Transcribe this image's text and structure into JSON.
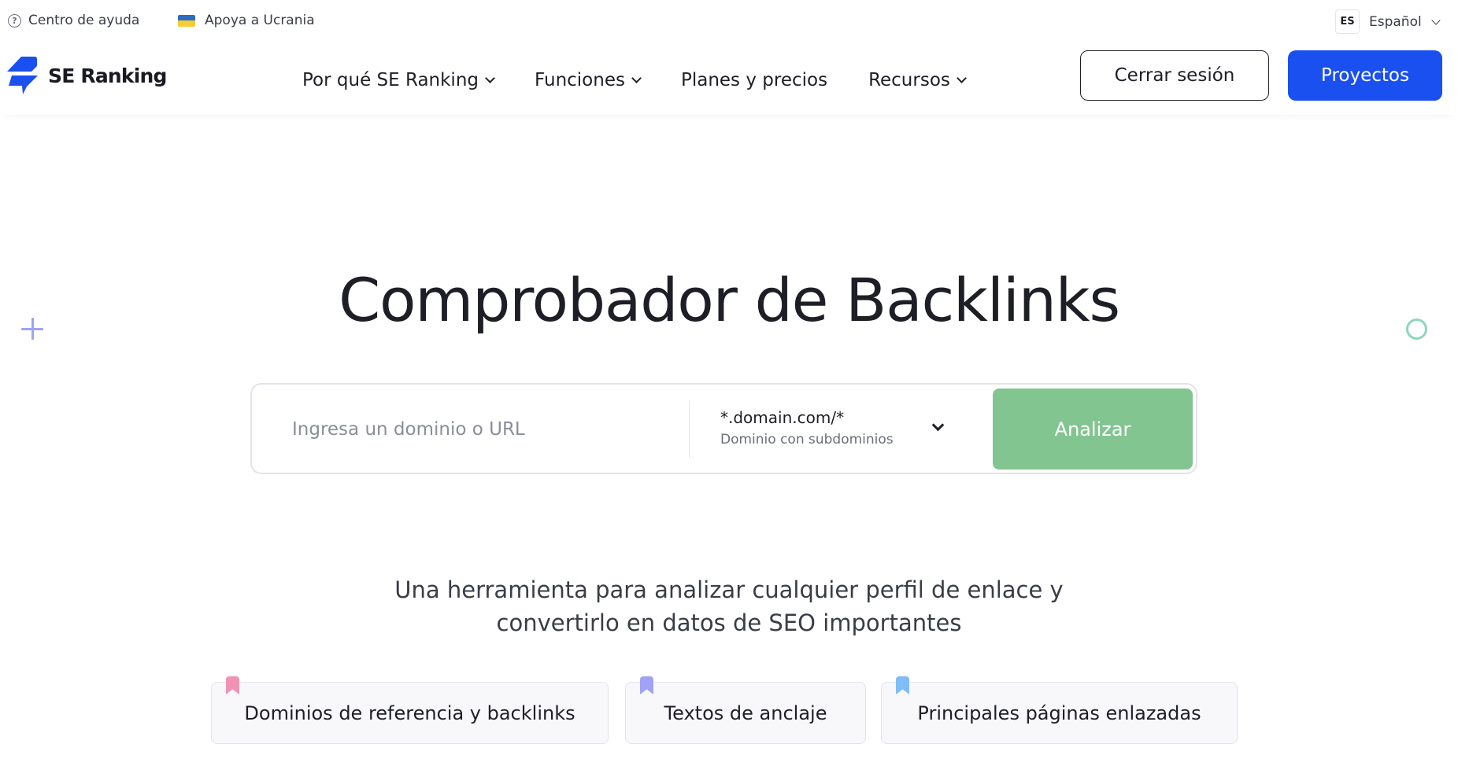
{
  "topbar": {
    "help_label": "Centro de ayuda",
    "help_icon": "question-circle-icon",
    "ukraine_label": "Apoya a Ucrania",
    "ukraine_icon": "ukraine-flag-icon",
    "language_code": "ES",
    "language_label": "Español"
  },
  "header": {
    "logo_text": "SE Ranking",
    "nav": [
      {
        "label": "Por qué SE Ranking",
        "has_dropdown": true
      },
      {
        "label": "Funciones",
        "has_dropdown": true
      },
      {
        "label": "Planes y precios",
        "has_dropdown": false
      },
      {
        "label": "Recursos",
        "has_dropdown": true
      }
    ],
    "logout_label": "Cerrar sesión",
    "projects_label": "Proyectos"
  },
  "hero": {
    "title": "Comprobador de Backlinks",
    "search": {
      "placeholder": "Ingresa un dominio o URL",
      "value": "",
      "scope_value": "*.domain.com/*",
      "scope_description": "Dominio con subdominios",
      "analyze_label": "Analizar"
    },
    "subtitle_line1": "Una herramienta para analizar cualquier perfil de enlace y",
    "subtitle_line2": "convertirlo en datos de SEO importantes"
  },
  "features": [
    {
      "label": "Dominios de referencia y backlinks",
      "bookmark_color": "#f093b3"
    },
    {
      "label": "Textos de anclaje",
      "bookmark_color": "#a0a2f5"
    },
    {
      "label": "Principales páginas enlazadas",
      "bookmark_color": "#80bdf7"
    }
  ],
  "colors": {
    "brand_blue": "#1a4ff0",
    "analyze_green": "#82c590",
    "deco_plus": "#9ea3f6",
    "deco_circle": "#8dd6bb"
  }
}
